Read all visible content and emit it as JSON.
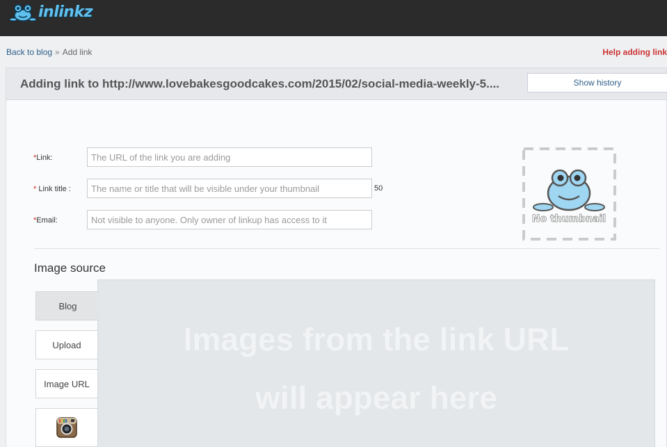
{
  "header": {
    "logo_text": "inlinkz"
  },
  "breadcrumb": {
    "back": "Back to blog",
    "separator": "»",
    "current": "Add link"
  },
  "help": {
    "label": "Help adding link"
  },
  "panel": {
    "title": "Adding link to http://www.lovebakesgoodcakes.com/2015/02/social-media-weekly-5....",
    "history_button": "Show history"
  },
  "form": {
    "link": {
      "required_mark": "*",
      "label": "Link:",
      "placeholder": "The URL of the link you are adding",
      "value": ""
    },
    "title": {
      "required_mark": "*",
      "label": " Link title :",
      "placeholder": "The name or title that will be visible under your thumbnail",
      "value": "",
      "char_count": "50"
    },
    "email": {
      "required_mark": "*",
      "label": "Email:",
      "placeholder": "Not visible to anyone. Only owner of linkup has access to it",
      "value": ""
    }
  },
  "thumbnail": {
    "text": "No thumbnail"
  },
  "image_source": {
    "title": "Image source",
    "tabs": [
      {
        "label": "Blog",
        "active": true
      },
      {
        "label": "Upload",
        "active": false
      },
      {
        "label": "Image URL",
        "active": false
      }
    ],
    "placeholder_line1": "Images from the link URL",
    "placeholder_line2": "will appear here"
  },
  "icons": {
    "logo": "frog-logo-icon",
    "thumbnail": "frog-placeholder-icon",
    "tab4": "instagram-icon"
  },
  "colors": {
    "topbar": "#2b2b2b",
    "link": "#2e5f8a",
    "help": "#cc3333",
    "logo": "#5fc0ee"
  }
}
